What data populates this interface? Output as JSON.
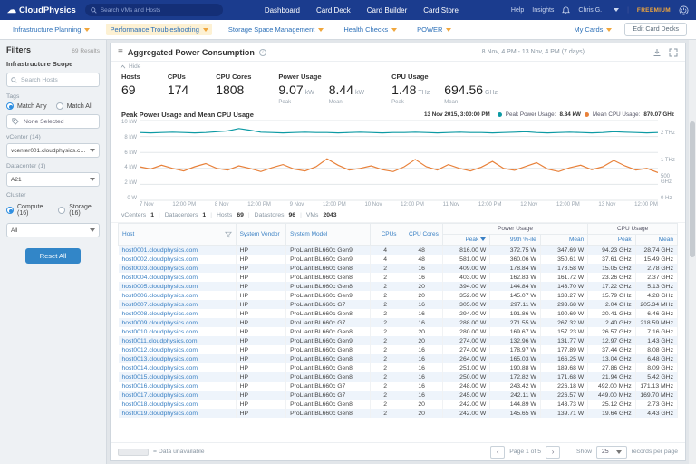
{
  "topnav": {
    "brand": "CloudPhysics",
    "search_placeholder": "Search VMs and Hosts",
    "items": [
      "Dashboard",
      "Card Deck",
      "Card Builder",
      "Card Store"
    ],
    "right": {
      "help": "Help",
      "insights": "Insights",
      "user": "Chris G.",
      "plan": "FREEMIUM"
    }
  },
  "subnav": {
    "items": [
      {
        "label": "Infrastructure Planning",
        "active": false
      },
      {
        "label": "Performance Troubleshooting",
        "active": true
      },
      {
        "label": "Storage Space Management",
        "active": false
      },
      {
        "label": "Health Checks",
        "active": false
      },
      {
        "label": "POWER",
        "active": false
      }
    ],
    "my_cards": "My Cards",
    "edit_decks": "Edit Card Decks"
  },
  "sidebar": {
    "filters_title": "Filters",
    "results": "69 Results",
    "scope_title": "Infrastructure Scope",
    "search_placeholder": "Search Hosts",
    "tags_label": "Tags",
    "match_any": "Match Any",
    "match_all": "Match All",
    "none_selected": "None Selected",
    "vcenter_label": "vCenter (14)",
    "vcenter_value": "vcenter001.cloudphysics.com",
    "datacenter_label": "Datacenter (1)",
    "datacenter_value": "A21",
    "cluster_label": "Cluster",
    "compute": "Compute (16)",
    "storage": "Storage (16)",
    "cluster_value": "All",
    "reset": "Reset All"
  },
  "card": {
    "title": "Aggregated Power Consumption",
    "date_range": "8 Nov, 4 PM - 13 Nov, 4 PM (7 days)",
    "hide": "Hide",
    "stats": [
      {
        "label": "Hosts",
        "value": "69"
      },
      {
        "label": "CPUs",
        "value": "174"
      },
      {
        "label": "CPU Cores",
        "value": "1808"
      }
    ],
    "power_stat": {
      "label": "Power Usage",
      "peak_value": "9.07",
      "peak_unit": "kW",
      "peak_caption": "Peak",
      "mean_value": "8.44",
      "mean_unit": "kW",
      "mean_caption": "Mean"
    },
    "cpu_stat": {
      "label": "CPU Usage",
      "peak_value": "1.48",
      "peak_unit": "THz",
      "peak_caption": "Peak",
      "mean_value": "694.56",
      "mean_unit": "GHz",
      "mean_caption": "Mean"
    }
  },
  "chart_data": {
    "type": "line",
    "title": "Peak Power Usage and Mean CPU Usage",
    "timestamp_label": "13 Nov 2015, 3:00:00 PM",
    "legend": [
      {
        "name": "Peak Power Usage:",
        "value": "8.84 kW",
        "color": "#0d9aa4"
      },
      {
        "name": "Mean CPU Usage:",
        "value": "870.07 GHz",
        "color": "#e8813a"
      }
    ],
    "y_left_ticks": [
      "10 kW",
      "8 kW",
      "6 kW",
      "4 kW",
      "2 kW",
      "0 W"
    ],
    "y_right_ticks": [
      "",
      "2 THz",
      "",
      "1 THz",
      "500 GHz",
      "0 Hz"
    ],
    "x_ticks": [
      "7 Nov",
      "12:00 PM",
      "8 Nov",
      "12:00 PM",
      "9 Nov",
      "12:00 PM",
      "10 Nov",
      "12:00 PM",
      "11 Nov",
      "12:00 PM",
      "12 Nov",
      "12:00 PM",
      "13 Nov",
      "12:00 PM"
    ],
    "y_left_max_kw": 10,
    "series": [
      {
        "name": "Peak Power Usage",
        "unit": "kW",
        "color": "#0d9aa4",
        "scale_to_kw": 1,
        "values": [
          8.5,
          8.45,
          8.5,
          8.55,
          8.5,
          8.45,
          8.5,
          8.6,
          8.7,
          9.0,
          8.8,
          8.55,
          8.5,
          8.45,
          8.5,
          8.55,
          8.5,
          8.5,
          8.45,
          8.5,
          8.55,
          8.5,
          8.45,
          8.5,
          8.5,
          8.55,
          8.5,
          8.45,
          8.5,
          8.55,
          8.5,
          8.5,
          8.45,
          8.5,
          8.55,
          8.6,
          8.5,
          8.45,
          8.5,
          8.55,
          8.5,
          8.45,
          8.5,
          8.6,
          8.55,
          8.5,
          8.45,
          8.5
        ]
      },
      {
        "name": "Mean CPU Usage",
        "unit": "THz",
        "color": "#e8813a",
        "scale_to_kw": 4,
        "values": [
          1.05,
          0.98,
          1.1,
          1.0,
          0.92,
          1.05,
          1.15,
          1.0,
          0.95,
          1.08,
          1.0,
          0.9,
          1.02,
          1.12,
          0.98,
          0.92,
          1.05,
          1.3,
          1.1,
          0.95,
          1.0,
          1.08,
          0.96,
          0.9,
          1.05,
          1.28,
          1.05,
          0.95,
          1.12,
          1.0,
          0.92,
          1.04,
          1.22,
          1.0,
          0.94,
          1.06,
          1.18,
          0.98,
          0.9,
          1.02,
          1.1,
          0.96,
          1.05,
          1.25,
          1.08,
          0.95,
          1.0,
          0.87
        ]
      }
    ]
  },
  "summary": {
    "items": [
      {
        "label": "vCenters",
        "value": "1"
      },
      {
        "label": "Datacenters",
        "value": "1"
      },
      {
        "label": "Hosts",
        "value": "69"
      },
      {
        "label": "Datastores",
        "value": "96"
      },
      {
        "label": "VMs",
        "value": "2043"
      }
    ]
  },
  "table": {
    "headers": {
      "host": "Host",
      "vendor": "System Vendor",
      "model": "System Model",
      "cpus": "CPUs",
      "cores": "CPU Cores",
      "power_group": "Power Usage",
      "cpu_group": "CPU Usage",
      "peak": "Peak",
      "p99": "99th %-ile",
      "mean": "Mean"
    },
    "rows": [
      [
        "host0001.cloudphysics.com",
        "HP",
        "ProLiant BL660c Gen9",
        "4",
        "48",
        "816.00 W",
        "372.75 W",
        "347.69 W",
        "94.23 GHz",
        "28.74 GHz"
      ],
      [
        "host0002.cloudphysics.com",
        "HP",
        "ProLiant BL660c Gen9",
        "4",
        "48",
        "581.00 W",
        "360.06 W",
        "350.61 W",
        "37.61 GHz",
        "15.49 GHz"
      ],
      [
        "host0003.cloudphysics.com",
        "HP",
        "ProLiant BL660c Gen8",
        "2",
        "16",
        "409.00 W",
        "178.84 W",
        "173.58 W",
        "15.05 GHz",
        "2.78 GHz"
      ],
      [
        "host0004.cloudphysics.com",
        "HP",
        "ProLiant BL660c Gen8",
        "2",
        "16",
        "403.00 W",
        "162.83 W",
        "161.72 W",
        "23.26 GHz",
        "2.37 GHz"
      ],
      [
        "host0005.cloudphysics.com",
        "HP",
        "ProLiant BL660c Gen8",
        "2",
        "20",
        "394.00 W",
        "144.84 W",
        "143.70 W",
        "17.22 GHz",
        "5.13 GHz"
      ],
      [
        "host0006.cloudphysics.com",
        "HP",
        "ProLiant BL660c Gen9",
        "2",
        "20",
        "352.00 W",
        "145.07 W",
        "138.27 W",
        "15.79 GHz",
        "4.28 GHz"
      ],
      [
        "host0007.cloudphysics.com",
        "HP",
        "ProLiant BL660c G7",
        "2",
        "16",
        "305.00 W",
        "297.11 W",
        "293.68 W",
        "2.04 GHz",
        "205.34 MHz"
      ],
      [
        "host0008.cloudphysics.com",
        "HP",
        "ProLiant BL660c Gen8",
        "2",
        "16",
        "294.00 W",
        "191.86 W",
        "190.69 W",
        "20.41 GHz",
        "6.46 GHz"
      ],
      [
        "host0009.cloudphysics.com",
        "HP",
        "ProLiant BL660c G7",
        "2",
        "16",
        "288.00 W",
        "271.55 W",
        "267.32 W",
        "2.40 GHz",
        "218.59 MHz"
      ],
      [
        "host0010.cloudphysics.com",
        "HP",
        "ProLiant BL660c Gen8",
        "2",
        "20",
        "280.00 W",
        "169.67 W",
        "157.23 W",
        "26.57 GHz",
        "7.16 GHz"
      ],
      [
        "host0011.cloudphysics.com",
        "HP",
        "ProLiant BL660c Gen9",
        "2",
        "20",
        "274.00 W",
        "132.96 W",
        "131.77 W",
        "12.97 GHz",
        "1.43 GHz"
      ],
      [
        "host0012.cloudphysics.com",
        "HP",
        "ProLiant BL660c Gen8",
        "2",
        "16",
        "274.00 W",
        "178.97 W",
        "177.89 W",
        "37.44 GHz",
        "8.08 GHz"
      ],
      [
        "host0013.cloudphysics.com",
        "HP",
        "ProLiant BL660c Gen8",
        "2",
        "16",
        "264.00 W",
        "165.03 W",
        "166.25 W",
        "13.04 GHz",
        "6.48 GHz"
      ],
      [
        "host0014.cloudphysics.com",
        "HP",
        "ProLiant BL660c Gen8",
        "2",
        "16",
        "251.00 W",
        "190.88 W",
        "189.68 W",
        "27.86 GHz",
        "8.09 GHz"
      ],
      [
        "host0015.cloudphysics.com",
        "HP",
        "ProLiant BL660c Gen8",
        "2",
        "16",
        "250.00 W",
        "172.82 W",
        "171.68 W",
        "21.94 GHz",
        "5.42 GHz"
      ],
      [
        "host0016.cloudphysics.com",
        "HP",
        "ProLiant BL660c G7",
        "2",
        "16",
        "248.00 W",
        "243.42 W",
        "226.18 W",
        "492.00 MHz",
        "171.13 MHz"
      ],
      [
        "host0017.cloudphysics.com",
        "HP",
        "ProLiant BL660c G7",
        "2",
        "16",
        "245.00 W",
        "242.11 W",
        "226.57 W",
        "449.00 MHz",
        "169.70 MHz"
      ],
      [
        "host0018.cloudphysics.com",
        "HP",
        "ProLiant BL660c Gen8",
        "2",
        "20",
        "242.00 W",
        "144.89 W",
        "143.73 W",
        "25.12 GHz",
        "2.73 GHz"
      ],
      [
        "host0019.cloudphysics.com",
        "HP",
        "ProLiant BL660c Gen8",
        "2",
        "20",
        "242.00 W",
        "145.65 W",
        "139.71 W",
        "19.64 GHz",
        "4.43 GHz"
      ]
    ]
  },
  "footer": {
    "legend": "= Data unavailable",
    "page": "Page 1 of 5",
    "show": "Show",
    "page_size": "25",
    "records": "records per page"
  }
}
